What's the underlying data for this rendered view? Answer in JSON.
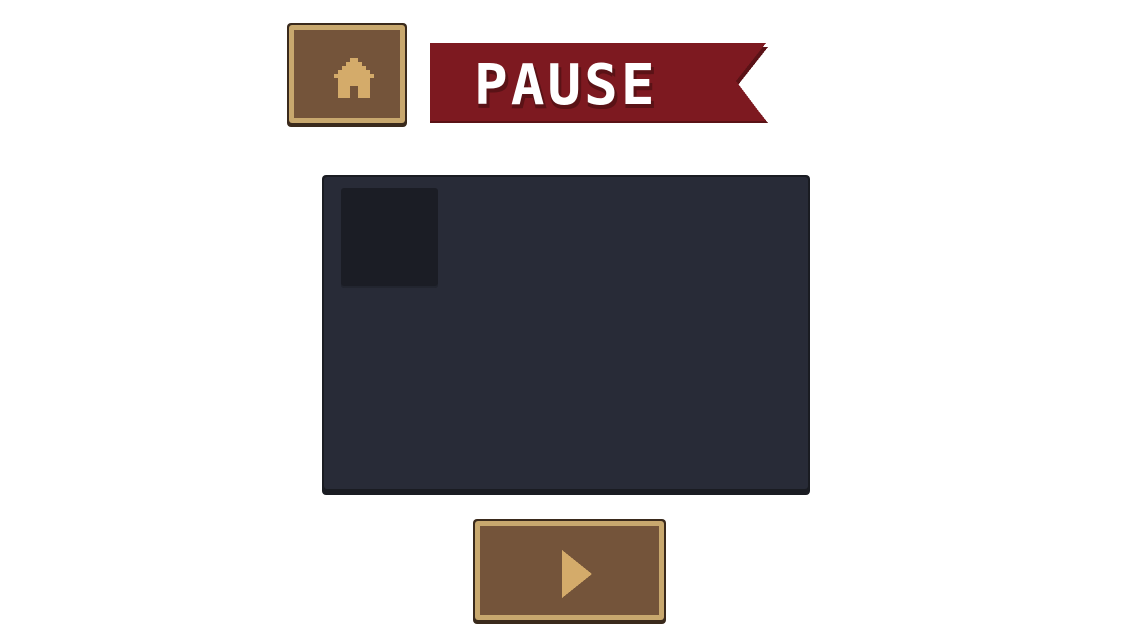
{
  "screen": {
    "title": "PAUSE"
  },
  "buttons": {
    "home": {
      "icon": "home-icon"
    },
    "resume": {
      "icon": "play-icon"
    }
  },
  "inventory": {
    "slots": [
      {
        "item": ""
      }
    ]
  },
  "colors": {
    "banner_red": "#7d1920",
    "button_wood": "#74543a",
    "button_trim": "#c8a86e",
    "panel_bg": "#282b37",
    "slot_bg": "#1b1d25",
    "icon_tan": "#d4ab6a"
  }
}
